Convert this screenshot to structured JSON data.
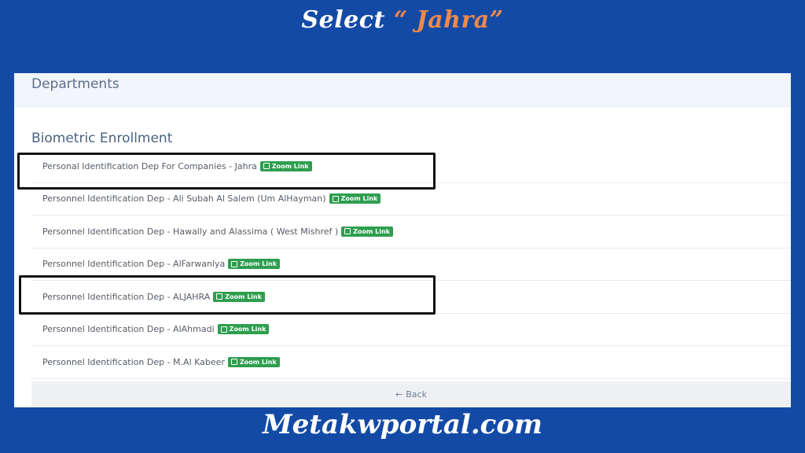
{
  "banner": {
    "prefix": "Select ",
    "highlight": "“ Jahra”",
    "highlight_color": "#f0894a"
  },
  "panel": {
    "header": "Departments",
    "section_title": "Biometric Enrollment",
    "items": [
      {
        "label": "Personal Identification Dep For Companies - Jahra",
        "badge": "Zoom Link"
      },
      {
        "label": "Personnel Identification Dep - Ali Subah Al Salem (Um AlHayman)",
        "badge": "Zoom Link"
      },
      {
        "label": "Personnel Identification Dep - Hawally and Alassima ( West Mishref )",
        "badge": "Zoom Link"
      },
      {
        "label": "Personnel Identification Dep - AlFarwanlya",
        "badge": "Zoom Link"
      },
      {
        "label": "Personnel Identification Dep - ALJAHRA",
        "badge": "Zoom Link"
      },
      {
        "label": "Personnel Identification Dep - AlAhmadi",
        "badge": "Zoom Link"
      },
      {
        "label": "Personnel Identification Dep - M.Al Kabeer",
        "badge": "Zoom Link"
      }
    ],
    "back": {
      "arrow": "←",
      "label": "Back"
    }
  },
  "site_footer": "Metakwportal.com",
  "colors": {
    "background": "#134aa6",
    "badge": "#2e9e4f",
    "highlight_box": "#111111"
  },
  "icons": {
    "badge_icon": "external-link-icon",
    "back_icon": "arrow-left-icon"
  }
}
